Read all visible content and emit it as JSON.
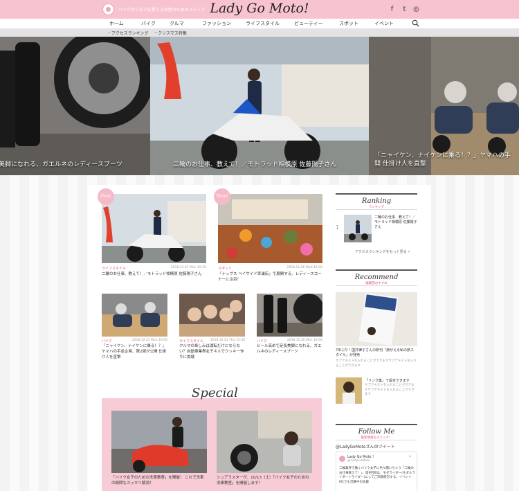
{
  "header": {
    "tagline": "バイクやクルマを愛する女性のためのメディア",
    "site_title": "Lady Go Moto!",
    "social": [
      {
        "icon": "facebook-icon",
        "glyph": "f"
      },
      {
        "icon": "twitter-icon",
        "glyph": "t"
      },
      {
        "icon": "instagram-icon",
        "glyph": "◎"
      }
    ]
  },
  "nav": {
    "items": [
      "ホーム",
      "バイク",
      "クルマ",
      "ファッション",
      "ライフスタイル",
      "ビューティー",
      "スポット",
      "イベント"
    ],
    "search_icon": "search-icon"
  },
  "subnav": {
    "items": [
      "・アクセスランキング",
      "・クリスマス特集"
    ]
  },
  "slider": {
    "slides": [
      {
        "caption": "美脚になれる、ガエルネのレディースブーツ"
      },
      {
        "caption": "二輪のお仕事、教えて！／モトラッド相模原 佐藤陽子さん"
      },
      {
        "caption": "「ニャイケン、ナイケンに乗る！？」ヤマハの手\n開 仕掛け人を直撃"
      }
    ]
  },
  "featured": [
    {
      "badge": "New!",
      "category": "ライフスタイル",
      "date": "2018.12.27 Mon 15:30",
      "title": "二輪のお仕事、教えて！／モトラッド相模原 佐藤陽子さん"
    },
    {
      "badge": "New!",
      "category": "スポット",
      "date": "2018.12.26 Wed 16:00",
      "title": "「ナップス ベイサイド幸浦店」で展開する、レディースコーナーに注目！"
    }
  ],
  "articles": [
    {
      "category": "バイク",
      "date": "2018.12.21 Mon 16:00",
      "title": "「ニャイケン、ナイケンに乗る！？」ヤマハの手並企画、第2弾が公開 仕掛け人を直撃"
    },
    {
      "category": "ライフスタイル",
      "date": "2018.12.21 Thu 15:30",
      "title": "クルマの楽しみは運転だけにならない？自動車業界女子４人でクッキー作りに挑戦"
    },
    {
      "category": "バイク",
      "date": "2018.12.20 Mon 16:00",
      "title": "ヒール高めで足長美脚になれる、ガエルネのレディースブーツ"
    }
  ],
  "special": {
    "heading": "Special",
    "items": [
      {
        "title": "「バイク女子のための洗車教室」を開催！ これで洗車の疑問もスッキリ解消！"
      },
      {
        "title": "シュアラスターが、10/13（土）「バイク女子のための洗車教室」を開催します！"
      }
    ]
  },
  "sidebar": {
    "ranking": {
      "heading": "Ranking",
      "sub": "ランキング",
      "items": [
        {
          "rank": "1",
          "title": "二輪のお仕事、教えて！／モトラッド相模原 佐藤陽子さん"
        }
      ],
      "more": "アクセスランキングをもっと見る »"
    },
    "recommend": {
      "heading": "Recommend",
      "sub": "編集部おすすめ",
      "book_title": "7年ぶり！国井律子さんの新刊「旅がえる私の旅スタイル」が発売",
      "book_note": "サブテキストを入れることができますサブテキストを入れることができます",
      "link_title": "「リンク集」で設定できます",
      "link_note": "サブテキストを入れることができますサブテキストを入れることができます"
    },
    "follow": {
      "heading": "Follow Me",
      "sub": "最新情報をチェック！",
      "tweets_label": "@LadyGoMotoさんのツイート",
      "account": "Lady Go Moto !",
      "handle": "@LadyGoMoto",
      "tweet": "二輪業界で働くバイク女子に色々聞いちゃう「二輪のお仕事教えて！」。第9回目は、モダライダー(モダルライダートライダー)にしてご両親経営する、イベントMCでも活躍中の佐藤"
    }
  }
}
